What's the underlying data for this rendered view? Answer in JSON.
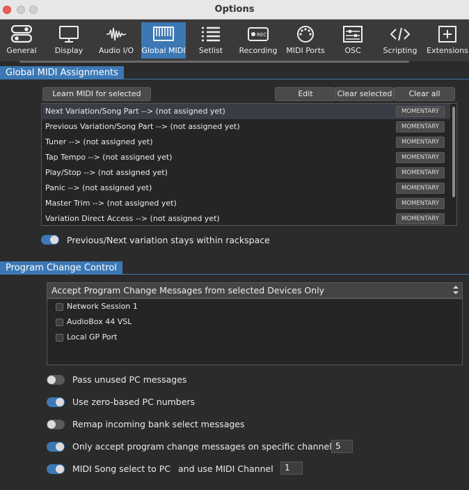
{
  "window": {
    "title": "Options"
  },
  "toolbar": {
    "tabs": [
      {
        "label": "General",
        "icon": "toggles-icon"
      },
      {
        "label": "Display",
        "icon": "monitor-icon"
      },
      {
        "label": "Audio I/O",
        "icon": "waveform-icon"
      },
      {
        "label": "Global MIDI",
        "icon": "keyboard-icon"
      },
      {
        "label": "Setlist",
        "icon": "list-icon"
      },
      {
        "label": "Recording",
        "icon": "rec-icon"
      },
      {
        "label": "MIDI Ports",
        "icon": "midi-port-icon"
      },
      {
        "label": "OSC",
        "icon": "osc-icon"
      },
      {
        "label": "Scripting",
        "icon": "code-icon"
      },
      {
        "label": "Extensions",
        "icon": "plus-box-icon"
      }
    ],
    "active": "Global MIDI"
  },
  "global_midi": {
    "heading": "Global MIDI Assignments",
    "learn_label": "Learn MIDI for selected item",
    "edit_label": "Edit",
    "clear_selected_label": "Clear selected",
    "clear_all_label": "Clear all",
    "assignments": [
      {
        "text": "Next Variation/Song Part --> (not assigned yet)",
        "mode": "MOMENTARY"
      },
      {
        "text": "Previous Variation/Song Part --> (not assigned yet)",
        "mode": "MOMENTARY"
      },
      {
        "text": "Tuner --> (not assigned yet)",
        "mode": "MOMENTARY"
      },
      {
        "text": "Tap Tempo --> (not assigned yet)",
        "mode": "MOMENTARY"
      },
      {
        "text": "Play/Stop --> (not assigned yet)",
        "mode": "MOMENTARY"
      },
      {
        "text": "Panic --> (not assigned yet)",
        "mode": "MOMENTARY"
      },
      {
        "text": "Master Trim --> (not assigned yet)",
        "mode": "MOMENTARY"
      },
      {
        "text": "Variation Direct Access --> (not assigned yet)",
        "mode": "MOMENTARY"
      }
    ],
    "stays_within_label": "Previous/Next variation stays within rackspace",
    "stays_within_on": true
  },
  "program_change": {
    "heading": "Program Change Control",
    "accept_mode": "Accept Program Change Messages from selected Devices Only",
    "devices": [
      {
        "name": "Network Session 1",
        "checked": false
      },
      {
        "name": "AudioBox 44 VSL",
        "checked": false
      },
      {
        "name": "Local GP Port",
        "checked": false
      }
    ],
    "options": {
      "pass_unused": {
        "label": "Pass unused PC messages",
        "on": false
      },
      "zero_based": {
        "label": "Use zero-based PC numbers",
        "on": true
      },
      "remap_bank": {
        "label": "Remap incoming bank select messages",
        "on": false
      },
      "specific_channel": {
        "label": "Only accept program change messages on specific channel",
        "on": true,
        "value": "5"
      },
      "song_select": {
        "label": "MIDI Song select to PC",
        "label2": "and use MIDI Channel",
        "on": true,
        "value": "1"
      }
    }
  },
  "colors": {
    "accent": "#3c78b4",
    "background": "#2b2b2b"
  }
}
